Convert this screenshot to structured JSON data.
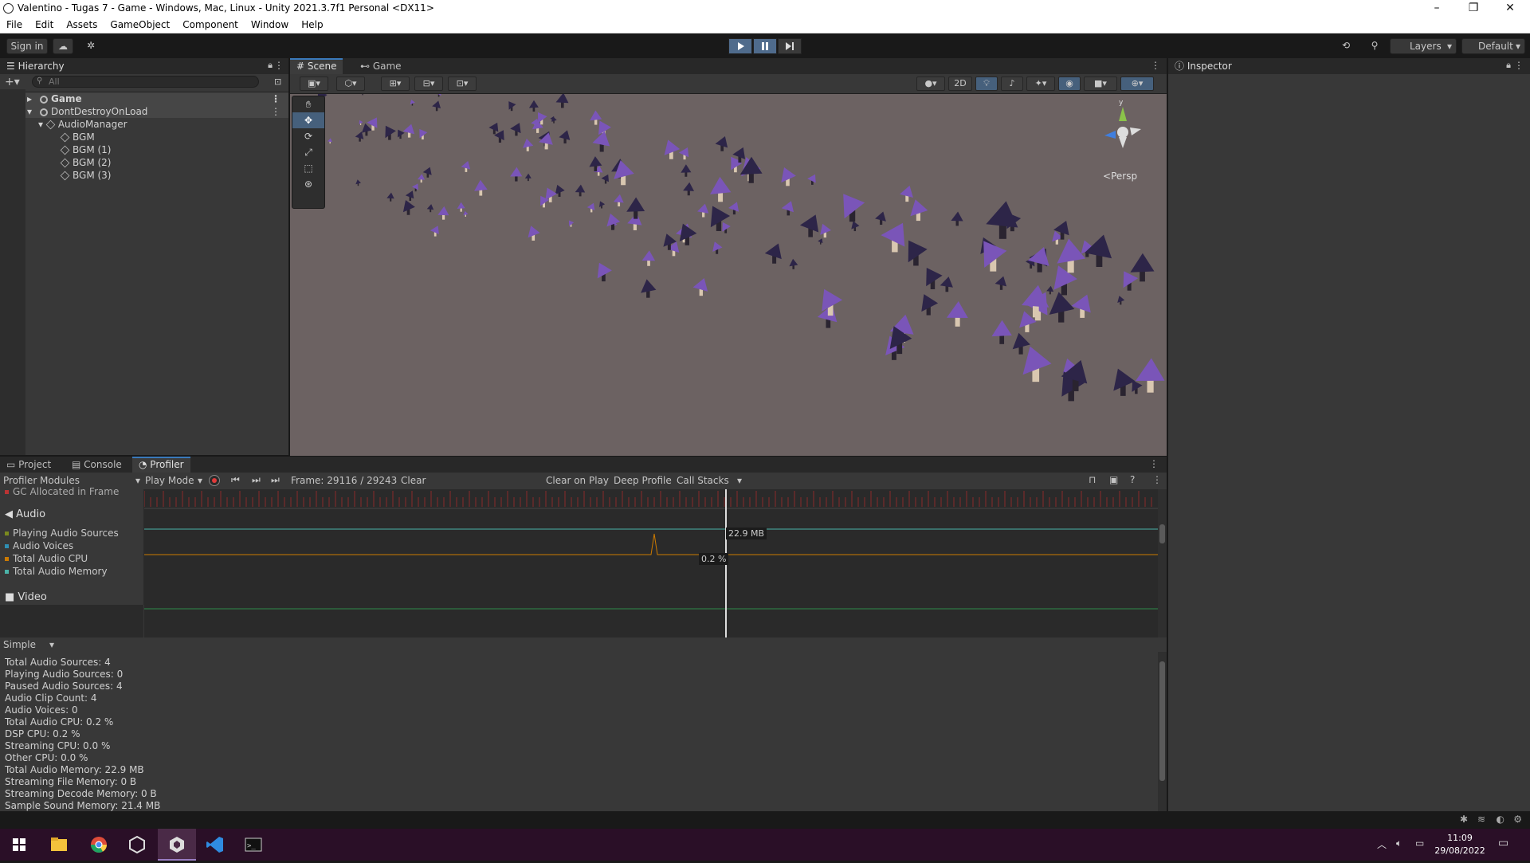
{
  "window": {
    "title": "Valentino - Tugas 7 - Game - Windows, Mac, Linux - Unity 2021.3.7f1 Personal <DX11>",
    "controls": [
      "–",
      "❐",
      "✕"
    ]
  },
  "menu": [
    "File",
    "Edit",
    "Assets",
    "GameObject",
    "Component",
    "Window",
    "Help"
  ],
  "toolbar": {
    "sign_in": "Sign in",
    "layers": "Layers",
    "layout": "Default"
  },
  "hierarchy": {
    "tab": "Hierarchy",
    "search_placeholder": "All",
    "items": [
      {
        "label": "Game",
        "depth": 0,
        "icon": "unity-scene-icon"
      },
      {
        "label": "DontDestroyOnLoad",
        "depth": 0,
        "icon": "unity-scene-icon"
      },
      {
        "label": "AudioManager",
        "depth": 1,
        "icon": "gameobject-icon"
      },
      {
        "label": "BGM",
        "depth": 2,
        "icon": "gameobject-icon"
      },
      {
        "label": "BGM (1)",
        "depth": 2,
        "icon": "gameobject-icon"
      },
      {
        "label": "BGM (2)",
        "depth": 2,
        "icon": "gameobject-icon"
      },
      {
        "label": "BGM (3)",
        "depth": 2,
        "icon": "gameobject-icon"
      }
    ]
  },
  "scene": {
    "tabs": [
      "Scene",
      "Game"
    ],
    "toolbar_2d": "2D",
    "gizmo_label": "Persp",
    "gizmo_axis": "y",
    "background": "#6c6262",
    "mushroom_color": "#7a55b8"
  },
  "inspector": {
    "tab": "Inspector"
  },
  "bottom_tabs": [
    "Project",
    "Console",
    "Profiler"
  ],
  "profiler": {
    "modules_label": "Profiler Modules",
    "play_mode": "Play Mode",
    "frame": "Frame: 29116 / 29243",
    "clear": "Clear",
    "clear_on_play": "Clear on Play",
    "deep_profile": "Deep Profile",
    "call_stacks": "Call Stacks",
    "gc_label": "GC Allocated in Frame",
    "audio_title": "Audio",
    "legend": [
      {
        "label": "Playing Audio Sources",
        "color": "#7a8a1f"
      },
      {
        "label": "Audio Voices",
        "color": "#2f8fb3"
      },
      {
        "label": "Total Audio CPU",
        "color": "#cc7a00"
      },
      {
        "label": "Total Audio Memory",
        "color": "#4bb3a8"
      }
    ],
    "video_title": "Video",
    "tooltip_memory": "22.9 MB",
    "tooltip_cpu": "0.2 %",
    "view_mode": "Simple",
    "stats": [
      "Total Audio Sources: 4",
      "Playing Audio Sources: 0",
      "Paused Audio Sources: 4",
      "Audio Clip Count: 4",
      "Audio Voices: 0",
      "Total Audio CPU: 0.2 %",
      "DSP CPU: 0.2 %",
      "Streaming CPU: 0.0 %",
      "Other CPU: 0.0 %",
      "Total Audio Memory: 22.9 MB",
      "Streaming File Memory: 0 B",
      "Streaming Decode Memory: 0 B",
      "Sample Sound Memory: 21.4 MB"
    ]
  },
  "taskbar": {
    "time": "11:09",
    "date": "29/08/2022",
    "apps": [
      "windows-start-icon",
      "file-explorer-icon",
      "chrome-icon",
      "unity-hub-icon",
      "unity-editor-icon",
      "vscode-icon",
      "terminal-icon"
    ]
  }
}
